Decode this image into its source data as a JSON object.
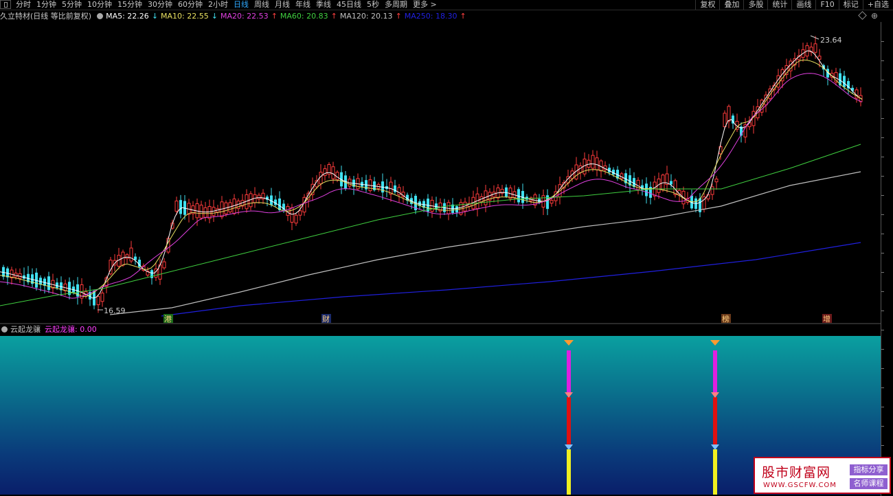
{
  "toolbar": {
    "periods": [
      "分时",
      "1分钟",
      "5分钟",
      "10分钟",
      "15分钟",
      "30分钟",
      "60分钟",
      "2小时",
      "日线",
      "周线",
      "月线",
      "年线",
      "季线",
      "45日线",
      "5秒",
      "多周期",
      "更多 >"
    ],
    "active_period": "日线",
    "right_buttons": [
      "复权",
      "叠加",
      "多股",
      "统计",
      "画线",
      "F10",
      "标记",
      "+自选"
    ]
  },
  "legend": {
    "title": "久立特材(日线 等比前复权)",
    "ma5": "MA5: 22.26",
    "ma5_arrow": "↓",
    "ma10": "MA10: 22.55",
    "ma10_arrow": "↓",
    "ma20": "MA20: 22.53",
    "ma20_arrow": "↑",
    "ma60": "MA60: 20.83",
    "ma60_arrow": "↑",
    "ma120": "MA120: 20.13",
    "ma120_arrow": "↑",
    "ma250": "MA250: 18.30",
    "ma250_arrow": "↑"
  },
  "colors": {
    "up": "#ff3b3b",
    "down": "#40e0f0",
    "ma5": "#ffffff",
    "ma10": "#e8e060",
    "ma20": "#e040e0",
    "ma60": "#40d040",
    "ma120": "#c0c0c0",
    "ma250": "#2020e0",
    "arrow_down": "#40e0f0",
    "arrow_up": "#ff4040"
  },
  "annotations": {
    "high_label": "23.64",
    "low_label": "16.59",
    "event_markers": [
      "港",
      "财",
      "榜",
      "增"
    ]
  },
  "sub_indicator": {
    "name": "云起龙骧",
    "value_label": "云起龙骧: 0.00"
  },
  "watermark": {
    "title": "股市财富网",
    "url": "WWW.GSCFW.COM",
    "tag1": "指标分享",
    "tag2": "名师课程"
  }
}
